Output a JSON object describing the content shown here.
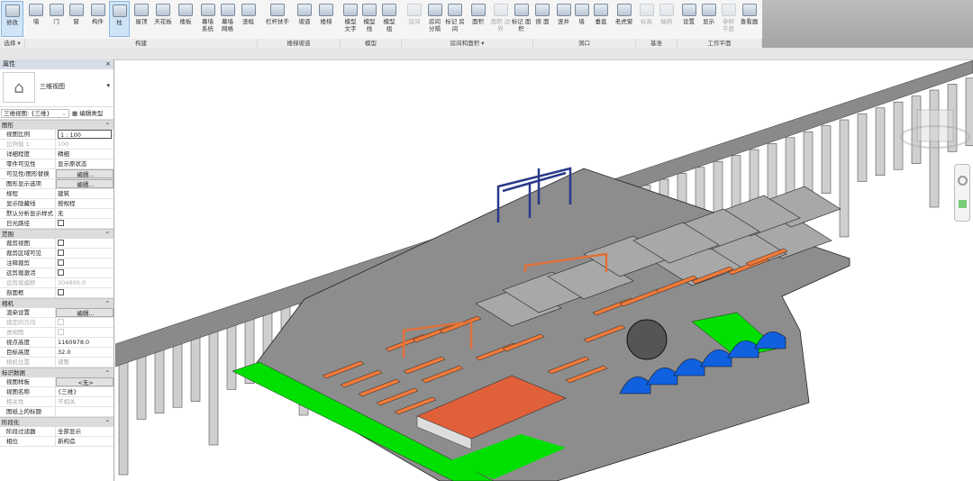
{
  "ribbon": {
    "buttons": [
      {
        "label": "修改",
        "icon": "cursor-icon",
        "selected": true
      },
      {
        "label": "墙",
        "icon": "wall-icon"
      },
      {
        "label": "门",
        "icon": "door-icon"
      },
      {
        "label": "窗",
        "icon": "window-icon"
      },
      {
        "label": "构件",
        "icon": "component-icon"
      },
      {
        "label": "柱",
        "icon": "column-icon",
        "selected": true
      },
      {
        "label": "屋顶",
        "icon": "roof-icon"
      },
      {
        "label": "天花板",
        "icon": "ceiling-icon"
      },
      {
        "label": "楼板",
        "icon": "floor-icon"
      },
      {
        "label": "幕墙 系统",
        "icon": "curtain-system-icon"
      },
      {
        "label": "幕墙 网格",
        "icon": "curtain-grid-icon"
      },
      {
        "label": "竖梃",
        "icon": "mullion-icon"
      },
      {
        "label": "栏杆扶手",
        "icon": "railing-icon"
      },
      {
        "label": "坡道",
        "icon": "ramp-icon"
      },
      {
        "label": "楼梯",
        "icon": "stair-icon"
      },
      {
        "label": "模型 文字",
        "icon": "model-text-icon"
      },
      {
        "label": "模型 线",
        "icon": "model-line-icon"
      },
      {
        "label": "模型 组",
        "icon": "model-group-icon"
      },
      {
        "label": "房间",
        "icon": "room-icon",
        "disabled": true
      },
      {
        "label": "房间 分隔",
        "icon": "room-separator-icon"
      },
      {
        "label": "标记 房间",
        "icon": "tag-room-icon"
      },
      {
        "label": "面积",
        "icon": "area-icon"
      },
      {
        "label": "面积 边界",
        "icon": "area-boundary-icon",
        "disabled": true
      },
      {
        "label": "标记 面积",
        "icon": "tag-area-icon"
      },
      {
        "label": "按 面",
        "icon": "by-face-icon"
      },
      {
        "label": "竖井",
        "icon": "shaft-icon"
      },
      {
        "label": "墙",
        "icon": "wall-opening-icon"
      },
      {
        "label": "垂直",
        "icon": "vertical-opening-icon"
      },
      {
        "label": "老虎窗",
        "icon": "dormer-icon"
      },
      {
        "label": "标高",
        "icon": "level-icon",
        "disabled": true
      },
      {
        "label": "轴网",
        "icon": "grid-icon",
        "disabled": true
      },
      {
        "label": "设置",
        "icon": "workplane-set-icon"
      },
      {
        "label": "显示",
        "icon": "workplane-show-icon"
      },
      {
        "label": "参照 平面",
        "icon": "ref-plane-icon",
        "disabled": true
      },
      {
        "label": "查看器",
        "icon": "viewer-icon"
      }
    ],
    "panels": [
      "选择 ▾",
      "构建",
      "楼梯坡道",
      "模型",
      "房间和面积 ▾",
      "洞口",
      "基准",
      "工作平面"
    ]
  },
  "properties": {
    "title": "属性",
    "close": "×",
    "type_name": "三维视图",
    "instance_selector": "三维视图: {三维}",
    "edit_type": "编辑类型",
    "sections": [
      {
        "name": "图形",
        "rows": [
          {
            "k": "视图比例",
            "v": "1 : 100",
            "t": "box"
          },
          {
            "k": "比例值 1:",
            "v": "100",
            "dis": true
          },
          {
            "k": "详细程度",
            "v": "精细"
          },
          {
            "k": "零件可见性",
            "v": "显示原状态"
          },
          {
            "k": "可见性/图形替换",
            "v": "编辑...",
            "t": "btn"
          },
          {
            "k": "图形显示选项",
            "v": "编辑...",
            "t": "btn"
          },
          {
            "k": "规程",
            "v": "建筑"
          },
          {
            "k": "显示隐藏线",
            "v": "按规程"
          },
          {
            "k": "默认分析显示样式",
            "v": "无"
          },
          {
            "k": "日光路径",
            "t": "cb"
          }
        ]
      },
      {
        "name": "范围",
        "rows": [
          {
            "k": "裁剪视图",
            "t": "cb"
          },
          {
            "k": "裁剪区域可见",
            "t": "cb"
          },
          {
            "k": "注释裁剪",
            "t": "cb"
          },
          {
            "k": "远剪裁激活",
            "t": "cb"
          },
          {
            "k": "远剪裁偏移",
            "v": "304800.0",
            "dis": true
          },
          {
            "k": "剖面框",
            "t": "cb"
          }
        ]
      },
      {
        "name": "相机",
        "rows": [
          {
            "k": "渲染设置",
            "v": "编辑...",
            "t": "btn"
          },
          {
            "k": "锁定的方向",
            "t": "cb",
            "dis": true
          },
          {
            "k": "透视图",
            "t": "cb",
            "dis": true
          },
          {
            "k": "视点高度",
            "v": "1160978.0"
          },
          {
            "k": "目标高度",
            "v": "32.0"
          },
          {
            "k": "相机位置",
            "v": "调整",
            "dis": true
          }
        ]
      },
      {
        "name": "标识数据",
        "rows": [
          {
            "k": "视图样板",
            "v": "<无>",
            "t": "btn"
          },
          {
            "k": "视图名称",
            "v": "{三维}"
          },
          {
            "k": "相关性",
            "v": "不相关",
            "dis": true
          },
          {
            "k": "图纸上的标题",
            "v": ""
          }
        ]
      },
      {
        "name": "阶段化",
        "rows": [
          {
            "k": "阶段过滤器",
            "v": "全部显示"
          },
          {
            "k": "相位",
            "v": "新构造"
          }
        ]
      }
    ]
  },
  "colors": {
    "deck": "#8c8c8c",
    "beam": "#f07a3a",
    "ground": "#00e000",
    "dome": "#1060e0",
    "gantry": "#2a3a8a"
  }
}
